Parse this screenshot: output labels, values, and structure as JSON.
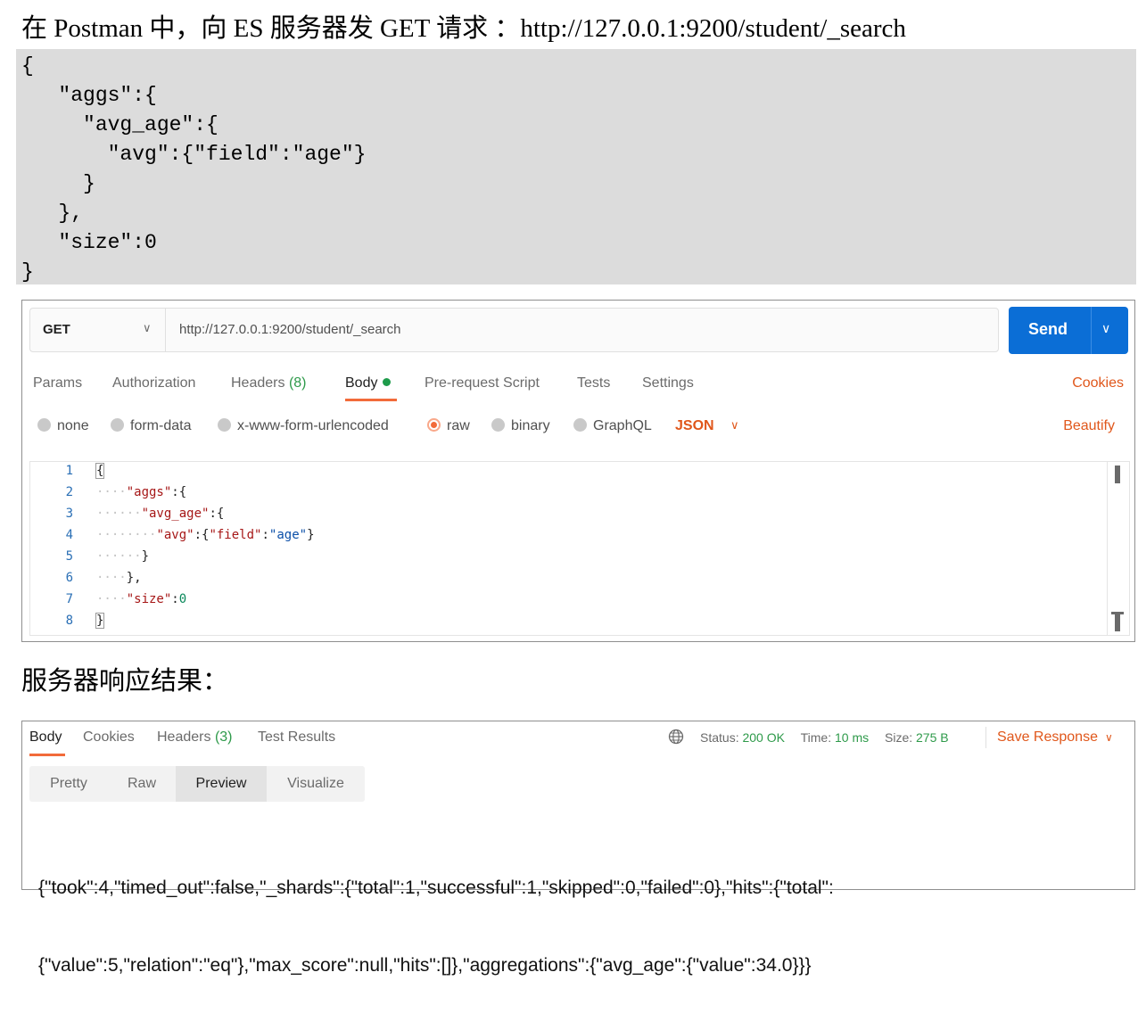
{
  "intro_line": "在 Postman 中，向 ES 服务器发 GET 请求 ：http://127.0.0.1:9200/student/_search",
  "code_block": {
    "lines": [
      "{",
      "   \"aggs\":{",
      "     \"avg_age\":{",
      "       \"avg\":{\"field\":\"age\"}",
      "     }",
      "   },",
      "   \"size\":0",
      "}"
    ]
  },
  "request": {
    "method": "GET",
    "url": "http://127.0.0.1:9200/student/_search",
    "send_label": "Send",
    "tabs": [
      {
        "label": "Params"
      },
      {
        "label": "Authorization"
      },
      {
        "label": "Headers",
        "count": "(8)"
      },
      {
        "label": "Body"
      },
      {
        "label": "Pre-request Script"
      },
      {
        "label": "Tests"
      },
      {
        "label": "Settings"
      }
    ],
    "cookies_label": "Cookies",
    "body_types": [
      "none",
      "form-data",
      "x-www-form-urlencoded",
      "raw",
      "binary",
      "GraphQL"
    ],
    "selected_body_type": "raw",
    "language": "JSON",
    "beautify_label": "Beautify",
    "editor_line_numbers": [
      "1",
      "2",
      "3",
      "4",
      "5",
      "6",
      "7",
      "8"
    ]
  },
  "response_heading": "服务器响应结果：",
  "response": {
    "tabs": [
      {
        "label": "Body"
      },
      {
        "label": "Cookies"
      },
      {
        "label": "Headers",
        "count": "(3)"
      },
      {
        "label": "Test Results"
      }
    ],
    "status_label": "Status:",
    "status_value": "200 OK",
    "time_label": "Time:",
    "time_value": "10 ms",
    "size_label": "Size:",
    "size_value": "275 B",
    "save_label": "Save Response",
    "view_modes": [
      "Pretty",
      "Raw",
      "Preview",
      "Visualize"
    ],
    "selected_view": "Preview",
    "body_lines": [
      "{\"took\":4,\"timed_out\":false,\"_shards\":{\"total\":1,\"successful\":1,\"skipped\":0,\"failed\":0},\"hits\":{\"total\":",
      "{\"value\":5,\"relation\":\"eq\"},\"max_score\":null,\"hits\":[]},\"aggregations\":{\"avg_age\":{\"value\":34.0}}}"
    ]
  },
  "colors": {
    "accent_orange": "#f26b3a",
    "send_blue": "#0b6ed6",
    "count_green": "#2e9a4a"
  }
}
